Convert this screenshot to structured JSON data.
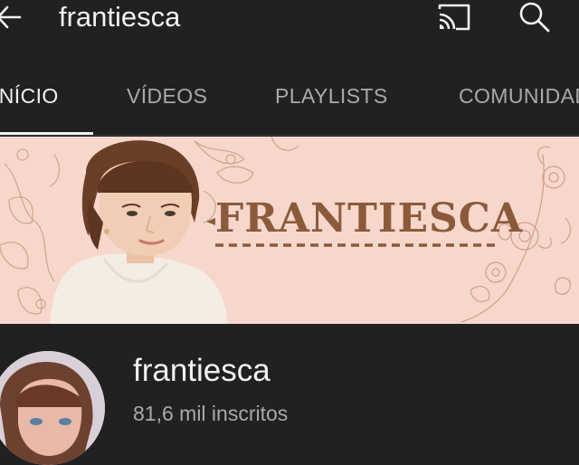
{
  "header": {
    "title": "frantiesca",
    "back_icon": "arrow-left-icon",
    "cast_icon": "cast-icon",
    "search_icon": "search-icon"
  },
  "tabs": [
    {
      "label": "INÍCIO",
      "active": true
    },
    {
      "label": "VÍDEOS",
      "active": false
    },
    {
      "label": "PLAYLISTS",
      "active": false
    },
    {
      "label": "COMUNIDADE",
      "active": false
    }
  ],
  "banner": {
    "text": "FRANTIESCA",
    "background_color": "#f7d7cc",
    "text_color": "#8a5a3a"
  },
  "channel": {
    "name": "frantiesca",
    "subscribers": "81,6 mil inscritos"
  },
  "colors": {
    "background": "#212121",
    "text_primary": "#f1f1f1",
    "text_secondary": "#aaaaaa"
  }
}
